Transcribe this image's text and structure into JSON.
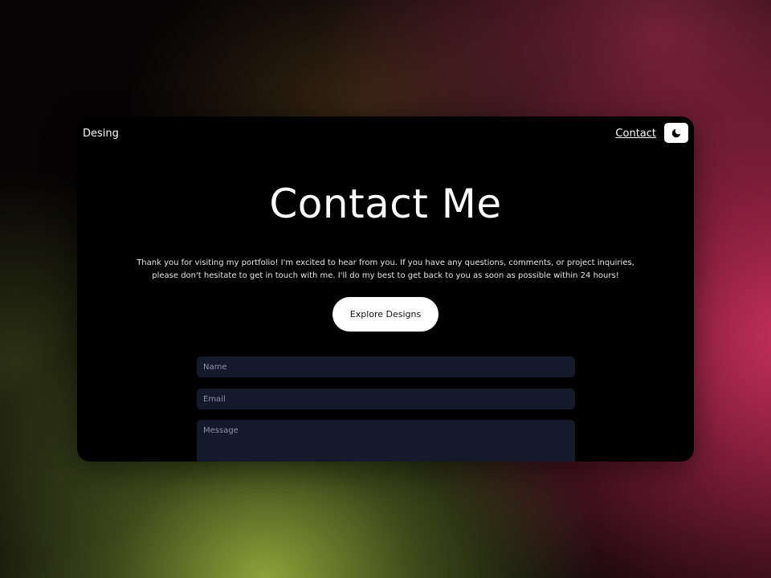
{
  "nav": {
    "brand": "Desing",
    "contact_link": "Contact",
    "theme_toggle_icon": "moon-icon"
  },
  "hero": {
    "title": "Contact Me",
    "intro": "Thank you for visiting my portfolio! I'm excited to hear from you. If you have any questions, comments, or project inquiries, please don't hesitate to get in touch with me. I'll do my best to get back to you as soon as possible within 24 hours!",
    "cta_label": "Explore Designs"
  },
  "form": {
    "name_placeholder": "Name",
    "email_placeholder": "Email",
    "message_placeholder": "Message"
  },
  "colors": {
    "window_background": "#000000",
    "input_background": "#141a2b",
    "button_background": "#ffffff",
    "accent_pink": "#c8325f",
    "accent_olive": "#96aa3c"
  }
}
